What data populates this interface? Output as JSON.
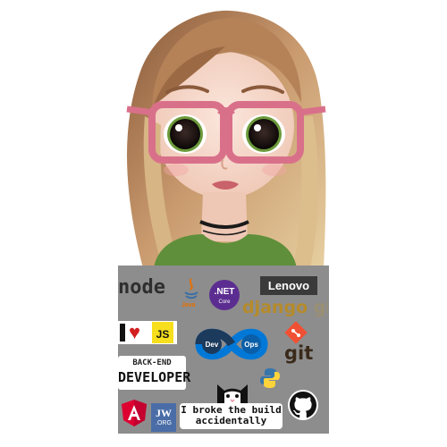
{
  "stickers": {
    "node": "node",
    "java": "Java",
    "net_title": ".NET",
    "net_sub": "Core",
    "lenovo": "Lenovo",
    "django": "django",
    "django_suffix": "girls",
    "ilove_js": "JS",
    "backend_top": "BACK-END",
    "backend_bottom": "DEVELOPER",
    "dev": "Dev",
    "ops": "Ops",
    "git": "git",
    "broke_line1": "I broke the build",
    "broke_line2": "accidentally",
    "jw_top": "JW",
    "jw_bottom": ".ORG"
  },
  "colors": {
    "laptop": "#8d8d8d",
    "net": "#5c2d91",
    "js": "#f7df1e",
    "angular": "#dd0031",
    "git": "#f05033",
    "devops": "#0078d7",
    "python_blue": "#3776ab",
    "python_yellow": "#ffd43b"
  },
  "icons": [
    "avatar-girl-illustration",
    "node-logo",
    "java-logo",
    "dotnet-logo",
    "lenovo-logo",
    "django-logo",
    "heart-icon",
    "devops-infinity-logo",
    "git-logo",
    "python-logo",
    "angular-logo",
    "cat-icon",
    "github-icon",
    "jw-logo"
  ]
}
